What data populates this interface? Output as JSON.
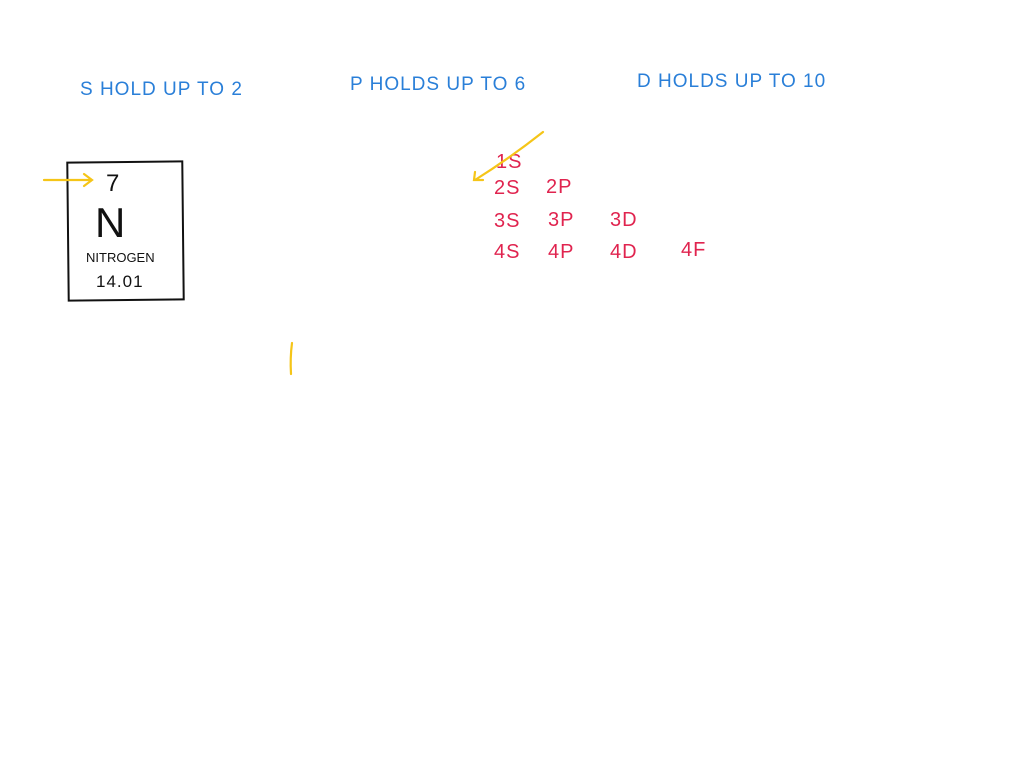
{
  "rules": [
    {
      "text": "S HOLD UP TO 2"
    },
    {
      "text": "P HOLDS UP TO 6"
    },
    {
      "text": "D HOLDS UP TO 10"
    }
  ],
  "element": {
    "atomic_number": "7",
    "symbol": "N",
    "name": "NITROGEN",
    "mass": "14.01"
  },
  "orbitals": [
    [
      "1S"
    ],
    [
      "2S",
      "2P"
    ],
    [
      "3S",
      "3P",
      "3D"
    ],
    [
      "4S",
      "4P",
      "4D",
      "4F"
    ]
  ],
  "colors": {
    "rules": "#2a7fd8",
    "orbitals": "#e0244f",
    "arrows": "#f5c518",
    "ink": "#111111"
  }
}
